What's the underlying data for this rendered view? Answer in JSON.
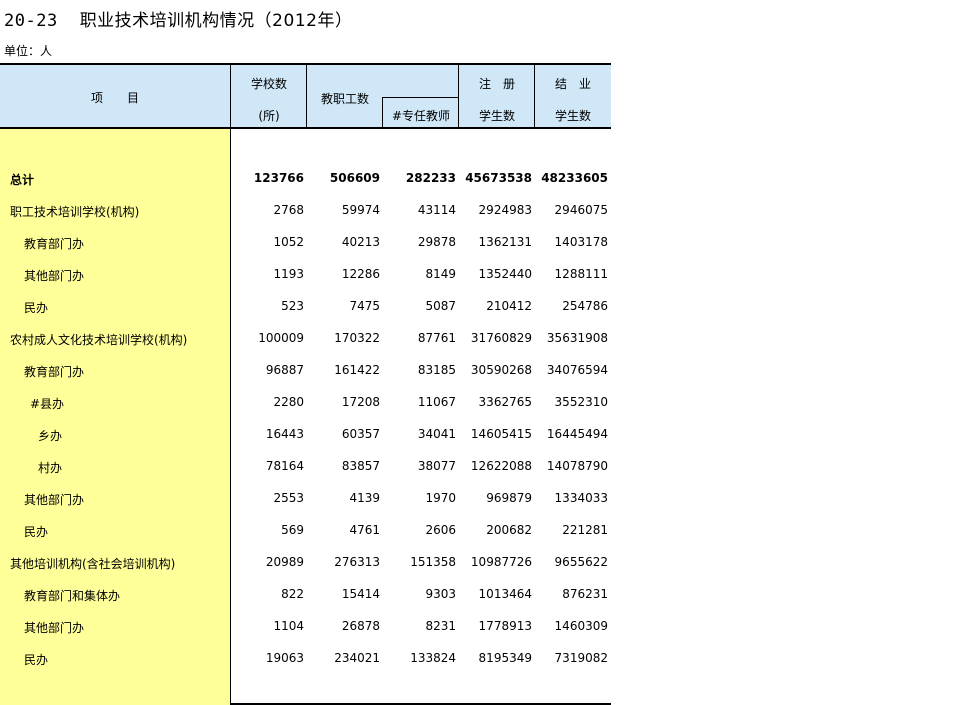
{
  "title": {
    "code": "20-23",
    "name": "职业技术培训机构情况（2012年）"
  },
  "unit": "单位：人",
  "header": {
    "item": "项　　目",
    "schools_top": "学校数",
    "schools_bottom": "(所)",
    "staff": "教职工数",
    "teachers": "#专任教师",
    "enrolled_top": "注　册",
    "enrolled_bottom": "学生数",
    "graduates_top": "结　业",
    "graduates_bottom": "学生数"
  },
  "rows": [
    {
      "label": "总计",
      "schools": "123766",
      "staff": "506609",
      "teachers": "282233",
      "enrolled": "45673538",
      "graduates": "48233605"
    },
    {
      "label": "职工技术培训学校(机构)",
      "schools": "2768",
      "staff": "59974",
      "teachers": "43114",
      "enrolled": "2924983",
      "graduates": "2946075"
    },
    {
      "label": "教育部门办",
      "schools": "1052",
      "staff": "40213",
      "teachers": "29878",
      "enrolled": "1362131",
      "graduates": "1403178"
    },
    {
      "label": "其他部门办",
      "schools": "1193",
      "staff": "12286",
      "teachers": "8149",
      "enrolled": "1352440",
      "graduates": "1288111"
    },
    {
      "label": "民办",
      "schools": "523",
      "staff": "7475",
      "teachers": "5087",
      "enrolled": "210412",
      "graduates": "254786"
    },
    {
      "label": "农村成人文化技术培训学校(机构)",
      "schools": "100009",
      "staff": "170322",
      "teachers": "87761",
      "enrolled": "31760829",
      "graduates": "35631908"
    },
    {
      "label": "教育部门办",
      "schools": "96887",
      "staff": "161422",
      "teachers": "83185",
      "enrolled": "30590268",
      "graduates": "34076594"
    },
    {
      "label": "#县办",
      "schools": "2280",
      "staff": "17208",
      "teachers": "11067",
      "enrolled": "3362765",
      "graduates": "3552310"
    },
    {
      "label": "乡办",
      "schools": "16443",
      "staff": "60357",
      "teachers": "34041",
      "enrolled": "14605415",
      "graduates": "16445494"
    },
    {
      "label": "村办",
      "schools": "78164",
      "staff": "83857",
      "teachers": "38077",
      "enrolled": "12622088",
      "graduates": "14078790"
    },
    {
      "label": "其他部门办",
      "schools": "2553",
      "staff": "4139",
      "teachers": "1970",
      "enrolled": "969879",
      "graduates": "1334033"
    },
    {
      "label": "民办",
      "schools": "569",
      "staff": "4761",
      "teachers": "2606",
      "enrolled": "200682",
      "graduates": "221281"
    },
    {
      "label": "其他培训机构(含社会培训机构)",
      "schools": "20989",
      "staff": "276313",
      "teachers": "151358",
      "enrolled": "10987726",
      "graduates": "9655622"
    },
    {
      "label": "教育部门和集体办",
      "schools": "822",
      "staff": "15414",
      "teachers": "9303",
      "enrolled": "1013464",
      "graduates": "876231"
    },
    {
      "label": "其他部门办",
      "schools": "1104",
      "staff": "26878",
      "teachers": "8231",
      "enrolled": "1778913",
      "graduates": "1460309"
    },
    {
      "label": "民办",
      "schools": "19063",
      "staff": "234021",
      "teachers": "133824",
      "enrolled": "8195349",
      "graduates": "7319082"
    }
  ]
}
